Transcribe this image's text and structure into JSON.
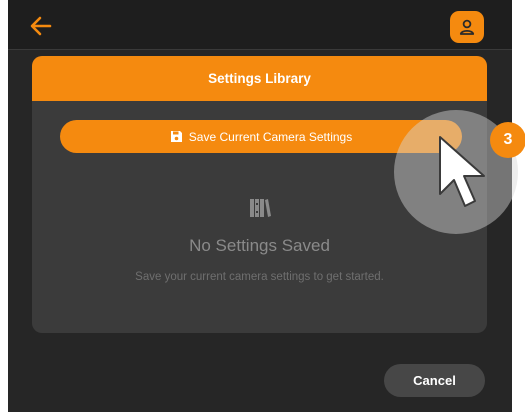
{
  "topbar": {
    "back_icon": "arrow-left-icon",
    "profile_icon": "user-icon"
  },
  "dialog": {
    "title": "Settings Library",
    "save_button_label": "Save Current Camera Settings",
    "save_button_icon": "floppy-disk-icon",
    "empty_icon": "books-icon",
    "empty_title": "No Settings Saved",
    "empty_subtitle": "Save your current camera settings to get started."
  },
  "footer": {
    "cancel_label": "Cancel"
  },
  "tutorial": {
    "step_number": "3",
    "cursor_icon": "pointer-cursor-icon"
  },
  "colors": {
    "accent": "#f58a0f",
    "background": "#262626",
    "panel": "#3b3b3b"
  }
}
